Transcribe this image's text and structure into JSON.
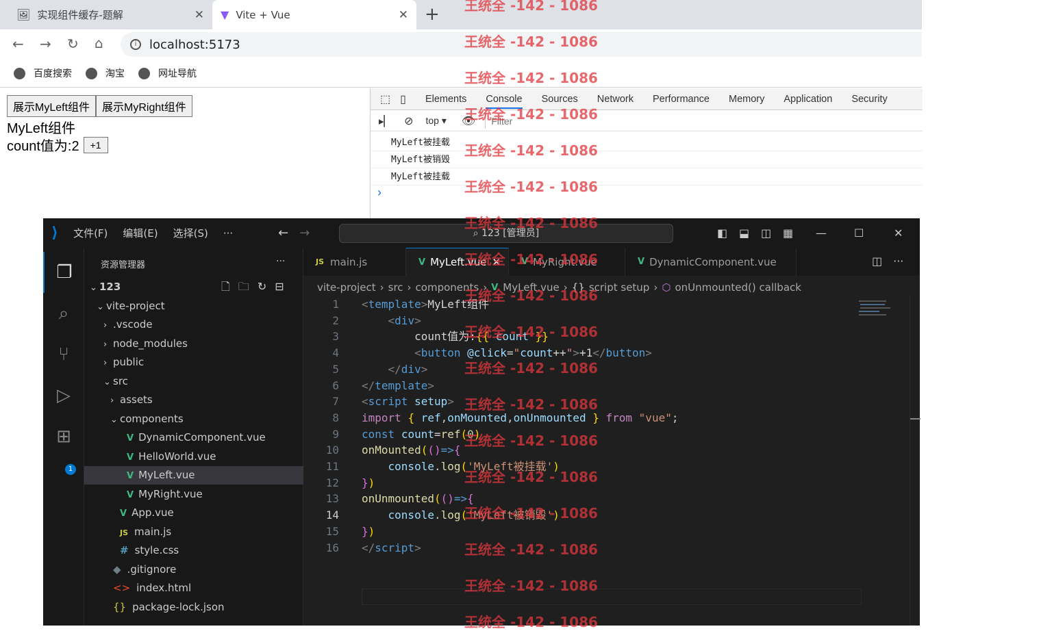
{
  "browser": {
    "tabs": [
      {
        "title": "实现组件缓存-题解",
        "icon": "tab-favicon-icon"
      },
      {
        "title": "Vite + Vue",
        "icon": "vite-icon"
      }
    ],
    "close_glyph": "✕",
    "new_tab_glyph": "+",
    "address": "localhost:5173",
    "bookmarks": [
      "百度搜索",
      "淘宝",
      "网址导航"
    ]
  },
  "page": {
    "buttons": [
      "展示MyLeft组件",
      "展示MyRight组件"
    ],
    "component_title": "MyLeft组件",
    "count_label": "count值为:2",
    "increment_label": "+1"
  },
  "devtools": {
    "tabs": [
      "Elements",
      "Console",
      "Sources",
      "Network",
      "Performance",
      "Memory",
      "Application",
      "Security"
    ],
    "active_tab": "Console",
    "context": "top",
    "filter_placeholder": "Filter",
    "logs": [
      "MyLeft被挂载",
      "MyLeft被销毁",
      "MyLeft被挂载"
    ],
    "prompt": "›"
  },
  "vscode": {
    "menus": [
      "文件(F)",
      "编辑(E)",
      "选择(S)",
      "···"
    ],
    "command_center": "123 [管理员]",
    "explorer_title": "资源管理器",
    "explorer_more": "···",
    "tree": [
      {
        "label": "123",
        "depth": 0,
        "chev": "v",
        "icon": "",
        "bold": true
      },
      {
        "label": "vite-project",
        "depth": 1,
        "chev": "v",
        "icon": ""
      },
      {
        "label": ".vscode",
        "depth": 2,
        "chev": ">",
        "icon": ""
      },
      {
        "label": "node_modules",
        "depth": 2,
        "chev": ">",
        "icon": ""
      },
      {
        "label": "public",
        "depth": 2,
        "chev": ">",
        "icon": ""
      },
      {
        "label": "src",
        "depth": 2,
        "chev": "v",
        "icon": ""
      },
      {
        "label": "assets",
        "depth": 3,
        "chev": ">",
        "icon": ""
      },
      {
        "label": "components",
        "depth": 3,
        "chev": "v",
        "icon": ""
      },
      {
        "label": "DynamicComponent.vue",
        "depth": 4,
        "chev": "",
        "icon": "vue"
      },
      {
        "label": "HelloWorld.vue",
        "depth": 4,
        "chev": "",
        "icon": "vue"
      },
      {
        "label": "MyLeft.vue",
        "depth": 4,
        "chev": "",
        "icon": "vue",
        "selected": true
      },
      {
        "label": "MyRight.vue",
        "depth": 4,
        "chev": "",
        "icon": "vue"
      },
      {
        "label": "App.vue",
        "depth": 3,
        "chev": "",
        "icon": "vue"
      },
      {
        "label": "main.js",
        "depth": 3,
        "chev": "",
        "icon": "js"
      },
      {
        "label": "style.css",
        "depth": 3,
        "chev": "",
        "icon": "css"
      },
      {
        "label": ".gitignore",
        "depth": 2,
        "chev": "",
        "icon": "git"
      },
      {
        "label": "index.html",
        "depth": 2,
        "chev": "",
        "icon": "html"
      },
      {
        "label": "package-lock.json",
        "depth": 2,
        "chev": "",
        "icon": "json"
      }
    ],
    "editor_tabs": [
      {
        "label": "main.js",
        "icon": "js"
      },
      {
        "label": "MyLeft.vue",
        "icon": "vue",
        "active": true
      },
      {
        "label": "MyRight.vue",
        "icon": "vue"
      },
      {
        "label": "DynamicComponent.vue",
        "icon": "vue"
      }
    ],
    "breadcrumbs": [
      "vite-project",
      "src",
      "components",
      "MyLeft.vue",
      "script setup",
      "onUnmounted() callback"
    ],
    "current_line": 14,
    "badge_count": "1"
  },
  "watermark": "王统全 -142 - 1086",
  "colors": {
    "accent": "#0078d4",
    "vue_green": "#41b883",
    "watermark": "#e0383e"
  }
}
